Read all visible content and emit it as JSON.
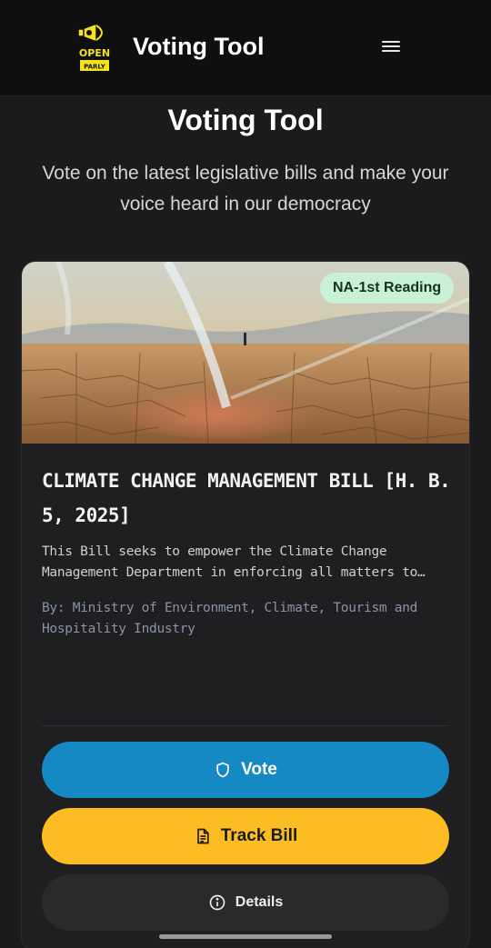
{
  "header": {
    "logo_text_top": "OPEN",
    "logo_text_bottom": "PARLY",
    "app_title": "Voting Tool",
    "menu_icon": "hamburger-menu-icon"
  },
  "page": {
    "title": "Voting Tool",
    "subtitle": "Vote on the latest legislative bills and make your voice heard in our democracy"
  },
  "bill_card": {
    "badge": "NA-1st Reading",
    "title": "CLIMATE CHANGE MANAGEMENT BILL [H. B. 5, 2025]",
    "description": "This Bill seeks to empower the Climate Change Management Department in enforcing all matters to…",
    "author": "By: Ministry of Environment, Climate, Tourism and Hospitality Industry",
    "actions": {
      "vote_label": "Vote",
      "vote_icon": "shield-icon",
      "track_label": "Track Bill",
      "track_icon": "document-icon",
      "details_label": "Details",
      "details_icon": "info-icon"
    }
  },
  "colors": {
    "background": "#1b1b1d",
    "vote_button": "#1489c4",
    "track_button": "#fbbd21",
    "badge_bg": "#c9f1d6",
    "logo_yellow": "#f5e21b"
  }
}
